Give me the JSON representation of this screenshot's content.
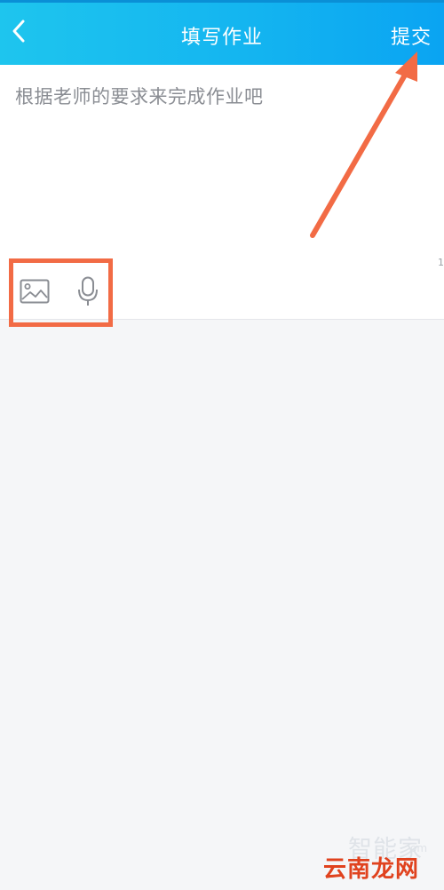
{
  "header": {
    "title": "填写作业",
    "submit_label": "提交",
    "back_icon": "chevron-left-icon"
  },
  "editor": {
    "placeholder": "根据老师的要求来完成作业吧",
    "edge_mark": "1"
  },
  "toolbar": {
    "tools": [
      {
        "icon": "image-icon"
      },
      {
        "icon": "microphone-icon"
      }
    ]
  },
  "watermark": {
    "top": "智能家",
    "sub": "om",
    "main": "云南龙网"
  },
  "colors": {
    "header_start": "#1ec5ee",
    "header_end": "#0aa4f2",
    "annotation": "#f26b45",
    "background": "#f5f6f8",
    "watermark_main": "#e0421e"
  }
}
